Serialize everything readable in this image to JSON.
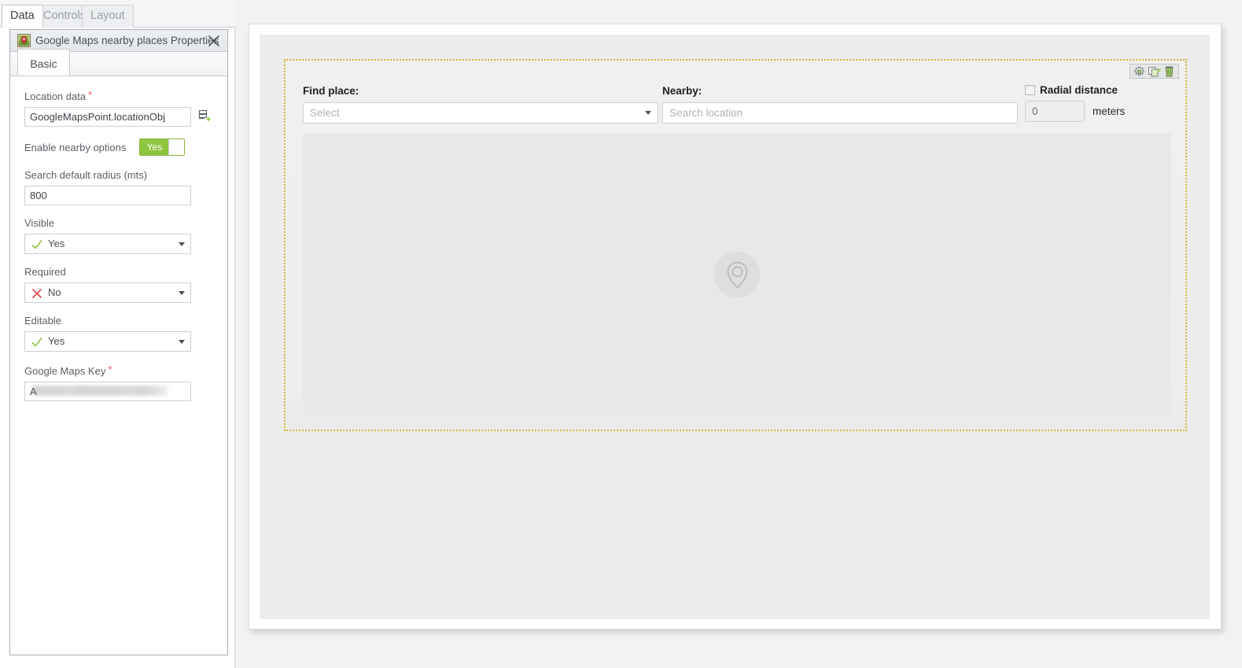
{
  "top_tabs": [
    {
      "label": "Data",
      "active": true
    },
    {
      "label": "Controls",
      "active": false
    },
    {
      "label": "Layout",
      "active": false
    }
  ],
  "properties_panel": {
    "title": "Google Maps nearby places Properties",
    "title_icon": "map-marker-icon",
    "close_icon": "close-icon",
    "subtabs": [
      {
        "label": "Basic",
        "active": true
      }
    ],
    "fields": {
      "location_data": {
        "label": "Location data",
        "required_marker": "*",
        "value": "GoogleMapsPoint.locationObj",
        "picker_icon": "data-selector-icon"
      },
      "enable_nearby": {
        "label": "Enable nearby options",
        "value": "Yes",
        "state": "on"
      },
      "search_radius": {
        "label": "Search default radius (mts)",
        "value": "800"
      },
      "visible": {
        "label": "Visible",
        "value": "Yes",
        "icon": "check-icon"
      },
      "required": {
        "label": "Required",
        "value": "No",
        "icon": "cross-icon"
      },
      "editable": {
        "label": "Editable",
        "value": "Yes",
        "icon": "check-icon"
      },
      "google_maps_key": {
        "label": "Google Maps Key",
        "required_marker": "*",
        "value": "A",
        "value_suffix": "c",
        "masked": true
      }
    }
  },
  "designer": {
    "widget_toolbar": [
      {
        "name": "settings-gear-icon"
      },
      {
        "name": "duplicate-icon"
      },
      {
        "name": "delete-trash-icon"
      }
    ],
    "find_place": {
      "label": "Find place:",
      "placeholder": "Select",
      "value": ""
    },
    "nearby": {
      "label": "Nearby:",
      "placeholder": "Search location",
      "value": ""
    },
    "radial_distance": {
      "label": "Radial distance",
      "checked": false,
      "placeholder": "0",
      "value": "",
      "units": "meters"
    },
    "map_placeholder": {
      "icon": "map-pin-icon"
    }
  },
  "colors": {
    "accent_green": "#8ec640",
    "required_red": "#e8524f",
    "selection_border": "#d9b33c",
    "check_green": "#8ec640",
    "cross_red": "#e24b4b"
  }
}
